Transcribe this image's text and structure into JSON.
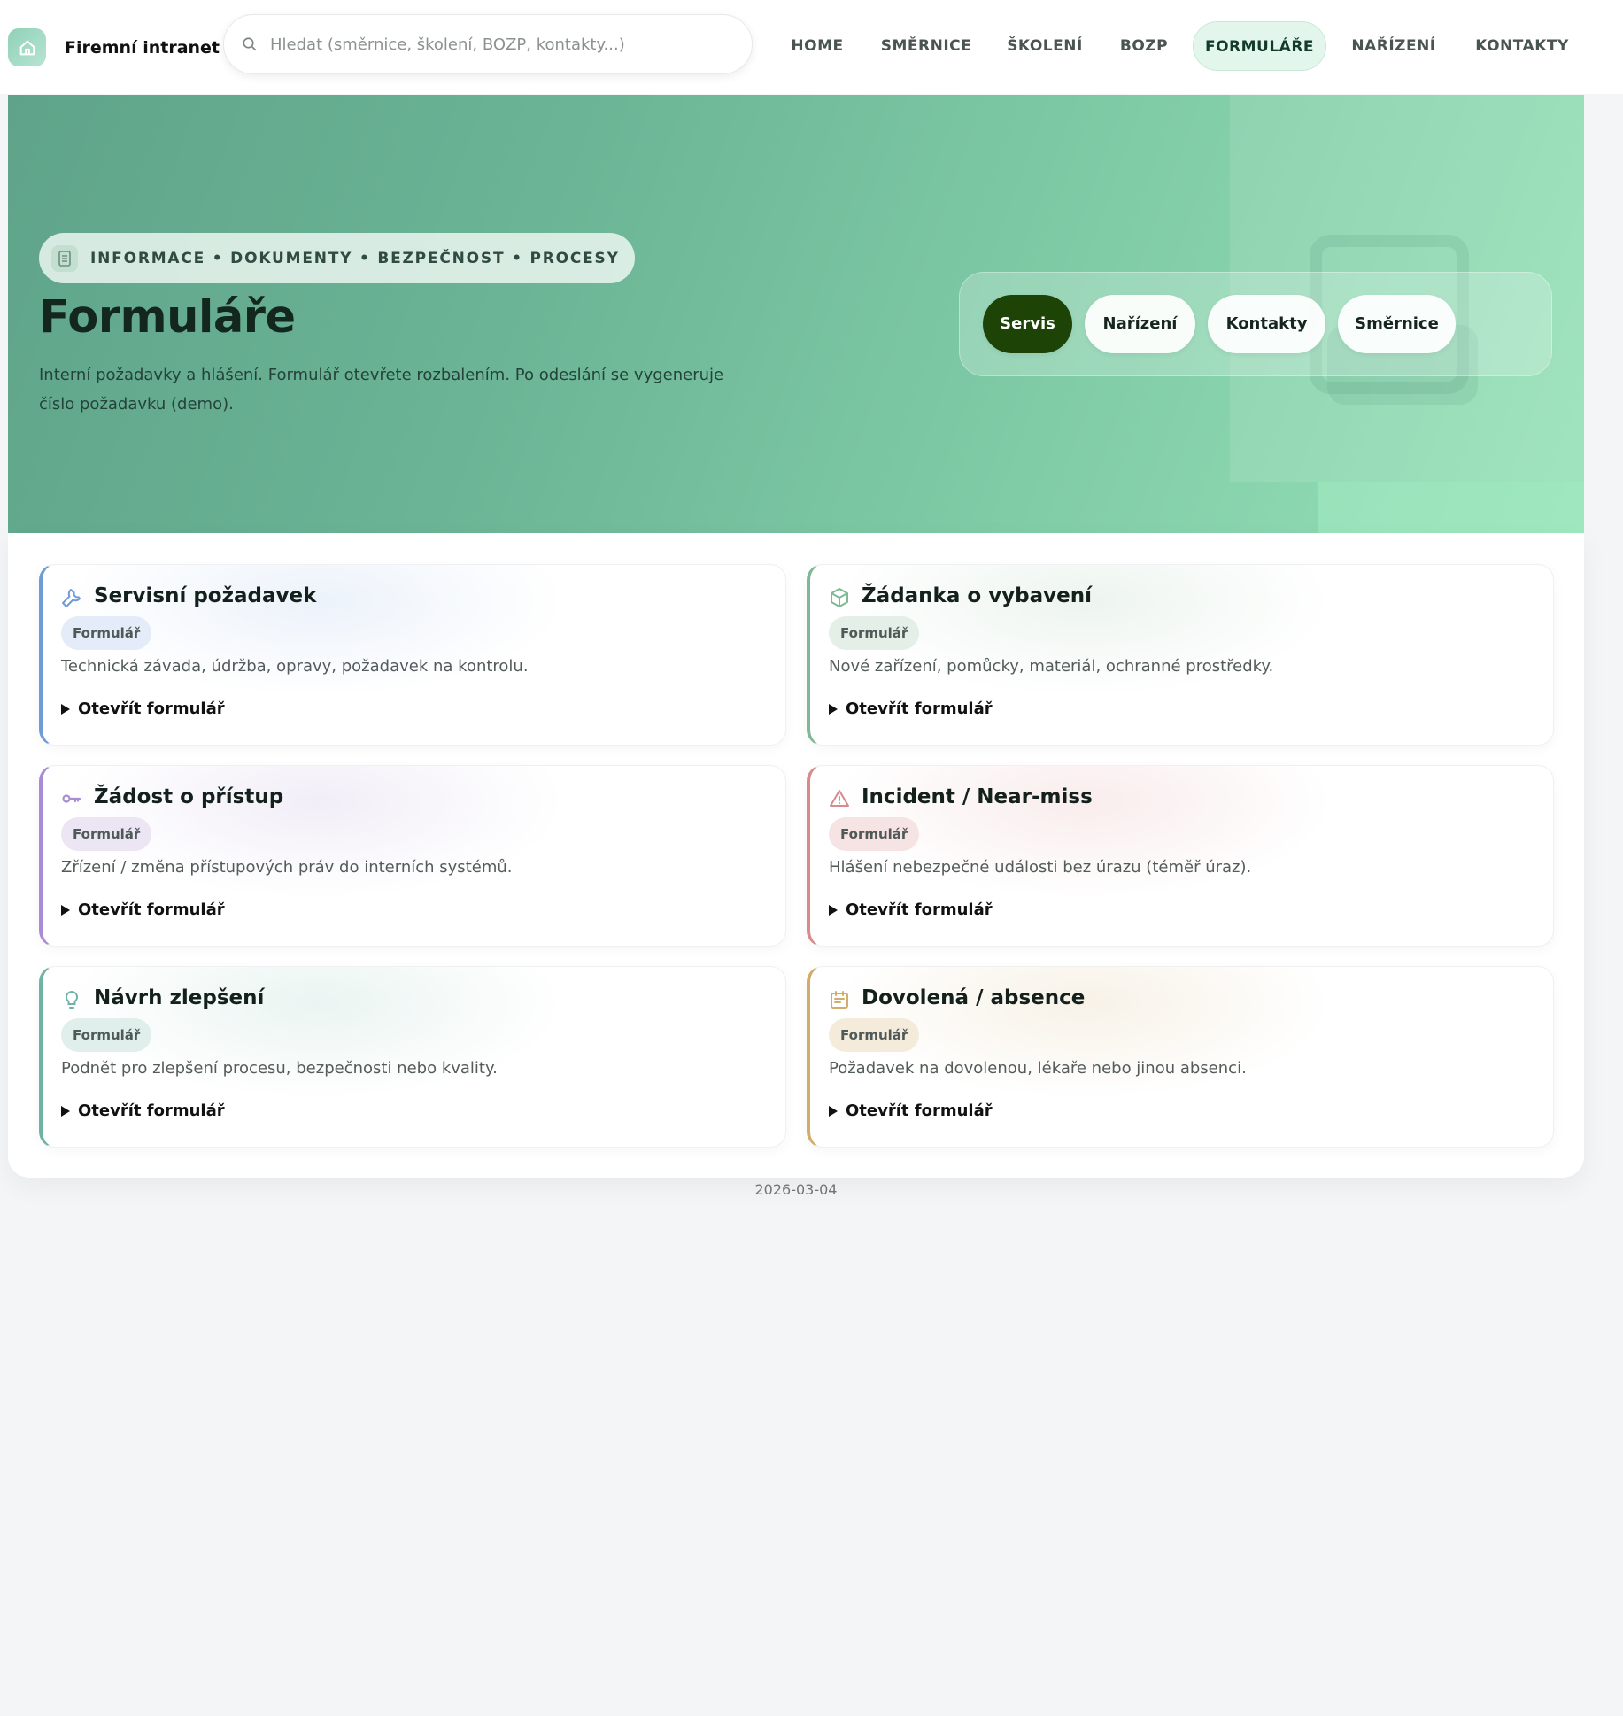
{
  "brand": {
    "name": "Firemní intranet",
    "icon": "home-icon",
    "icon_color": "#4a8f78"
  },
  "search": {
    "placeholder": "Hledat (směrnice, školení, BOZP, kontakty...)",
    "value": ""
  },
  "nav": {
    "items": [
      {
        "label": "HOME"
      },
      {
        "label": "SMĚRNICE"
      },
      {
        "label": "ŠKOLENÍ"
      },
      {
        "label": "BOZP"
      },
      {
        "label": "FORMULÁŘE",
        "active": true
      },
      {
        "label": "NAŘÍZENÍ"
      },
      {
        "label": "KONTAKTY"
      }
    ]
  },
  "hero": {
    "badge": "INFORMACE • DOKUMENTY • BEZPEČNOST • PROCESY",
    "badge_icon": "document-icon",
    "title": "Formuláře",
    "description": "Interní požadavky a hlášení. Formulář otevřete rozbalením. Po odeslání se vygeneruje číslo požadavku (demo).",
    "quick_links": [
      {
        "label": "Servis",
        "active": true
      },
      {
        "label": "Nařízení"
      },
      {
        "label": "Kontakty"
      },
      {
        "label": "Směrnice"
      }
    ]
  },
  "cards": [
    {
      "title": "Servisní požadavek",
      "tag": "Formulář",
      "description": "Technická závada, údržba, opravy, požadavek na kontrolu.",
      "link": "Otevřít formulář",
      "icon": "wrench-icon",
      "accent": "#6f9bd6",
      "tag_bg": "#e3ecf8"
    },
    {
      "title": "Žádanka o vybavení",
      "tag": "Formulář",
      "description": "Nové zařízení, pomůcky, materiál, ochranné prostředky.",
      "link": "Otevřít formulář",
      "icon": "package-icon",
      "accent": "#7fb894",
      "tag_bg": "#e4efe8"
    },
    {
      "title": "Žádost o přístup",
      "tag": "Formulář",
      "description": "Zřízení / změna přístupových práv do interních systémů.",
      "link": "Otevřít formulář",
      "icon": "key-icon",
      "accent": "#a98bd6",
      "tag_bg": "#ebe5f4"
    },
    {
      "title": "Incident / Near-miss",
      "tag": "Formulář",
      "description": "Hlášení nebezpečné události bez úrazu (téměř úraz).",
      "link": "Otevřít formulář",
      "icon": "warning-icon",
      "accent": "#d98a8a",
      "tag_bg": "#f6e3e3"
    },
    {
      "title": "Návrh zlepšení",
      "tag": "Formulář",
      "description": "Podnět pro zlepšení procesu, bezpečnosti nebo kvality.",
      "link": "Otevřít formulář",
      "icon": "lightbulb-icon",
      "accent": "#6fb3a4",
      "tag_bg": "#e0efeb"
    },
    {
      "title": "Dovolená / absence",
      "tag": "Formulář",
      "description": "Požadavek na dovolenou, lékaře nebo jinou absenci.",
      "link": "Otevřít formulář",
      "icon": "calendar-icon",
      "accent": "#d2ac6a",
      "tag_bg": "#f4ebdb"
    }
  ],
  "footer": {
    "date": "2026-03-04"
  }
}
